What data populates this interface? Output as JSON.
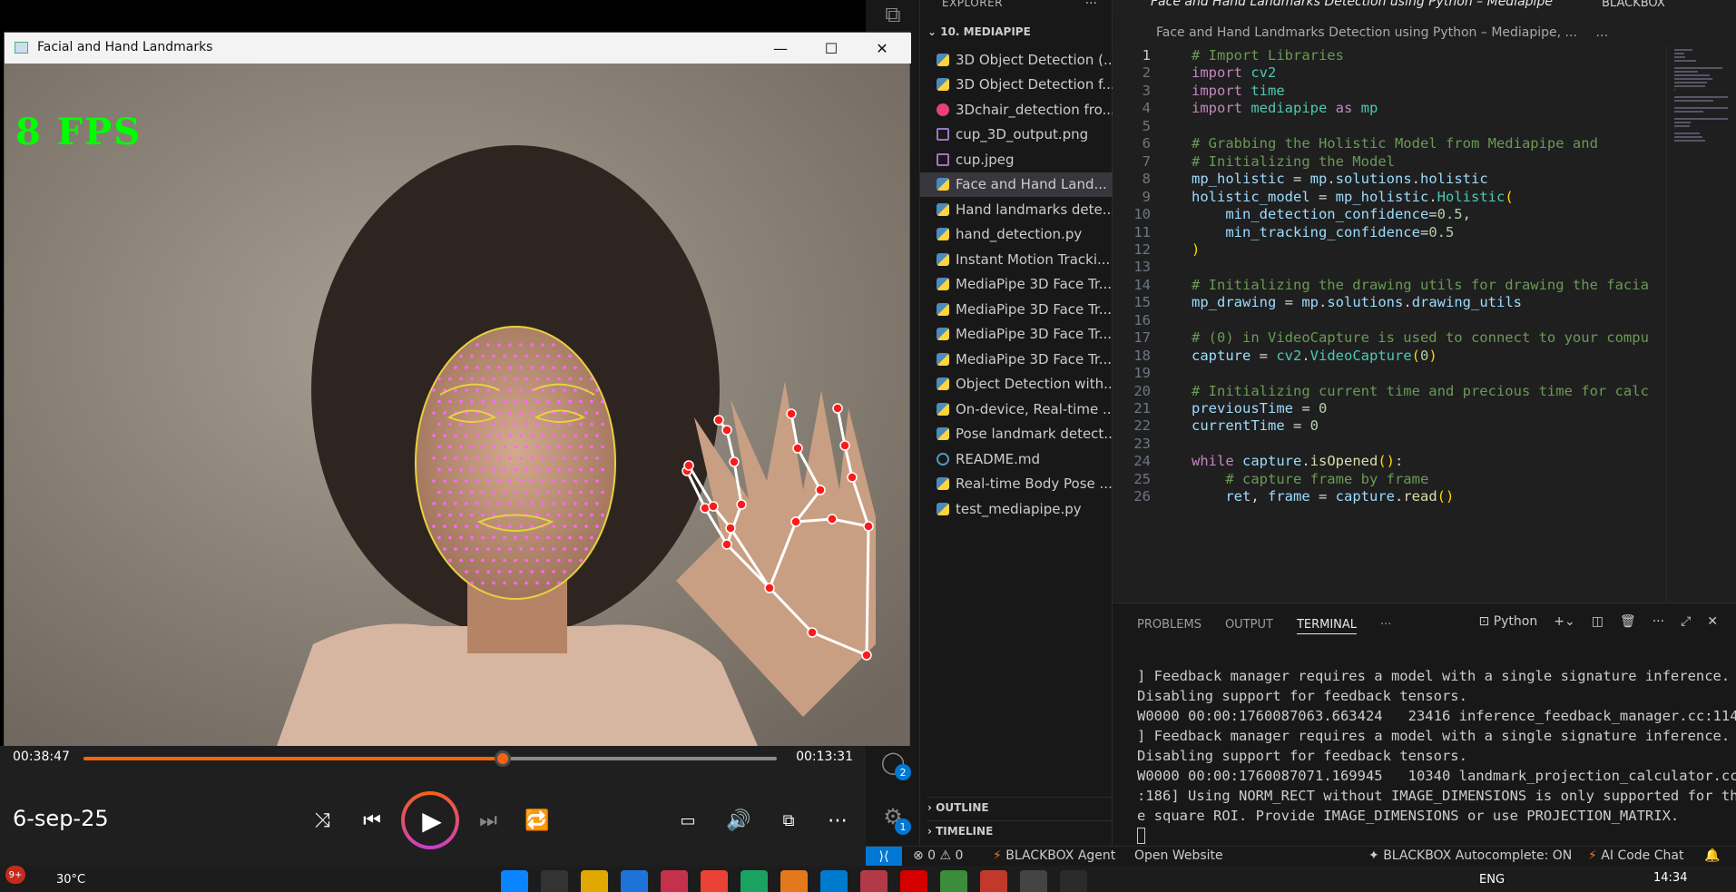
{
  "vscode": {
    "explorer_title": "EXPLORER",
    "explorer_more": "···",
    "folder": "10. MEDIAPIPE",
    "files": [
      {
        "name": "3D Object Detection (...",
        "type": "py"
      },
      {
        "name": "3D Object Detection f...",
        "type": "py"
      },
      {
        "name": "3Dchair_detection fro...",
        "type": "vid"
      },
      {
        "name": "cup_3D_output.png",
        "type": "img"
      },
      {
        "name": "cup.jpeg",
        "type": "img"
      },
      {
        "name": "Face and Hand Land...",
        "type": "py",
        "active": true
      },
      {
        "name": "Hand landmarks dete...",
        "type": "py"
      },
      {
        "name": "hand_detection.py",
        "type": "py"
      },
      {
        "name": "Instant Motion Tracki...",
        "type": "py"
      },
      {
        "name": "MediaPipe 3D Face Tr...",
        "type": "py"
      },
      {
        "name": "MediaPipe 3D Face Tr...",
        "type": "py"
      },
      {
        "name": "MediaPipe 3D Face Tr...",
        "type": "py"
      },
      {
        "name": "MediaPipe 3D Face Tr...",
        "type": "py"
      },
      {
        "name": "Object Detection with...",
        "type": "py"
      },
      {
        "name": "On-device, Real-time ...",
        "type": "py"
      },
      {
        "name": "Pose landmark detect...",
        "type": "py"
      },
      {
        "name": "README.md",
        "type": "info"
      },
      {
        "name": "Real-time Body Pose ...",
        "type": "py"
      },
      {
        "name": "test_mediapipe.py",
        "type": "py"
      }
    ],
    "outline_label": "OUTLINE",
    "timeline_label": "TIMELINE",
    "account_badge": "2",
    "settings_badge": "1",
    "tab_title": "Face and Hand Landmarks Detection using Python – Mediapipe",
    "blackbox_label": "BLACKBOX",
    "breadcrumb": "Face and Hand Landmarks Detection using Python – Mediapipe, ...",
    "breadcrumb_more": "…",
    "code": [
      {
        "n": "1",
        "parts": [
          [
            "c-cmt",
            "# Import Libraries"
          ]
        ]
      },
      {
        "n": "2",
        "parts": [
          [
            "c-kw",
            "import "
          ],
          [
            "c-mod",
            "cv2"
          ]
        ]
      },
      {
        "n": "3",
        "parts": [
          [
            "c-kw",
            "import "
          ],
          [
            "c-mod",
            "time"
          ]
        ]
      },
      {
        "n": "4",
        "parts": [
          [
            "c-kw",
            "import "
          ],
          [
            "c-mod",
            "mediapipe"
          ],
          [
            "c-kw",
            " as "
          ],
          [
            "c-mod",
            "mp"
          ]
        ]
      },
      {
        "n": "5",
        "parts": []
      },
      {
        "n": "6",
        "parts": [
          [
            "c-cmt",
            "# Grabbing the Holistic Model from Mediapipe and"
          ]
        ]
      },
      {
        "n": "7",
        "parts": [
          [
            "c-cmt",
            "# Initializing the Model"
          ]
        ]
      },
      {
        "n": "8",
        "parts": [
          [
            "c-var",
            "mp_holistic"
          ],
          [
            "c-pun",
            " = "
          ],
          [
            "c-var",
            "mp"
          ],
          [
            "c-pun",
            "."
          ],
          [
            "c-var",
            "solutions"
          ],
          [
            "c-pun",
            "."
          ],
          [
            "c-var",
            "holistic"
          ]
        ]
      },
      {
        "n": "9",
        "parts": [
          [
            "c-var",
            "holistic_model"
          ],
          [
            "c-pun",
            " = "
          ],
          [
            "c-var",
            "mp_holistic"
          ],
          [
            "c-pun",
            "."
          ],
          [
            "c-mod",
            "Holistic"
          ],
          [
            "c-br",
            "("
          ]
        ]
      },
      {
        "n": "10",
        "parts": [
          [
            "c-pun",
            "    "
          ],
          [
            "c-var",
            "min_detection_confidence"
          ],
          [
            "c-pun",
            "="
          ],
          [
            "c-num",
            "0.5"
          ],
          [
            "c-pun",
            ","
          ]
        ]
      },
      {
        "n": "11",
        "parts": [
          [
            "c-pun",
            "    "
          ],
          [
            "c-var",
            "min_tracking_confidence"
          ],
          [
            "c-pun",
            "="
          ],
          [
            "c-num",
            "0.5"
          ]
        ]
      },
      {
        "n": "12",
        "parts": [
          [
            "c-br",
            ")"
          ]
        ]
      },
      {
        "n": "13",
        "parts": []
      },
      {
        "n": "14",
        "parts": [
          [
            "c-cmt",
            "# Initializing the drawing utils for drawing the facia"
          ]
        ]
      },
      {
        "n": "15",
        "parts": [
          [
            "c-var",
            "mp_drawing"
          ],
          [
            "c-pun",
            " = "
          ],
          [
            "c-var",
            "mp"
          ],
          [
            "c-pun",
            "."
          ],
          [
            "c-var",
            "solutions"
          ],
          [
            "c-pun",
            "."
          ],
          [
            "c-var",
            "drawing_utils"
          ]
        ]
      },
      {
        "n": "16",
        "parts": []
      },
      {
        "n": "17",
        "parts": [
          [
            "c-cmt",
            "# (0) in VideoCapture is used to connect to your compu"
          ]
        ]
      },
      {
        "n": "18",
        "parts": [
          [
            "c-var",
            "capture"
          ],
          [
            "c-pun",
            " = "
          ],
          [
            "c-mod",
            "cv2"
          ],
          [
            "c-pun",
            "."
          ],
          [
            "c-mod",
            "VideoCapture"
          ],
          [
            "c-br",
            "("
          ],
          [
            "c-num",
            "0"
          ],
          [
            "c-br",
            ")"
          ]
        ]
      },
      {
        "n": "19",
        "parts": []
      },
      {
        "n": "20",
        "parts": [
          [
            "c-cmt",
            "# Initializing current time and precious time for calc"
          ]
        ]
      },
      {
        "n": "21",
        "parts": [
          [
            "c-var",
            "previousTime"
          ],
          [
            "c-pun",
            " = "
          ],
          [
            "c-num",
            "0"
          ]
        ]
      },
      {
        "n": "22",
        "parts": [
          [
            "c-var",
            "currentTime"
          ],
          [
            "c-pun",
            " = "
          ],
          [
            "c-num",
            "0"
          ]
        ]
      },
      {
        "n": "23",
        "parts": []
      },
      {
        "n": "24",
        "parts": [
          [
            "c-kw",
            "while "
          ],
          [
            "c-var",
            "capture"
          ],
          [
            "c-pun",
            "."
          ],
          [
            "c-fn",
            "isOpened"
          ],
          [
            "c-br",
            "()"
          ],
          [
            "c-pun",
            ":"
          ]
        ]
      },
      {
        "n": "25",
        "parts": [
          [
            "c-pun",
            "    "
          ],
          [
            "c-cmt",
            "# capture frame by frame"
          ]
        ]
      },
      {
        "n": "26",
        "parts": [
          [
            "c-pun",
            "    "
          ],
          [
            "c-var",
            "ret"
          ],
          [
            "c-pun",
            ", "
          ],
          [
            "c-var",
            "frame"
          ],
          [
            "c-pun",
            " = "
          ],
          [
            "c-var",
            "capture"
          ],
          [
            "c-pun",
            "."
          ],
          [
            "c-fn",
            "read"
          ],
          [
            "c-br",
            "()"
          ]
        ]
      }
    ],
    "panel_tabs": [
      "PROBLEMS",
      "OUTPUT",
      "TERMINAL",
      "···"
    ],
    "terminal_shell": "Python",
    "terminal": [
      "] Feedback manager requires a model with a single signature inference.",
      "Disabling support for feedback tensors.",
      "W0000 00:00:1760087063.663424   23416 inference_feedback_manager.cc:114",
      "] Feedback manager requires a model with a single signature inference.",
      "Disabling support for feedback tensors.",
      "W0000 00:00:1760087071.169945   10340 landmark_projection_calculator.cc",
      ":186] Using NORM_RECT without IMAGE_DIMENSIONS is only supported for th",
      "e square ROI. Provide IMAGE_DIMENSIONS or use PROJECTION_MATRIX.",
      ""
    ],
    "status": {
      "problems": "⊗ 0 ⚠ 0",
      "blackbox_agent": "BLACKBOX Agent",
      "open_website": "Open Website",
      "autocomplete": "BLACKBOX Autocomplete: ON",
      "ai_chat": "AI Code Chat"
    }
  },
  "player": {
    "window_title": "Facial and Hand Landmarks",
    "fps_text": "8 FPS",
    "time_elapsed": "00:38:47",
    "time_remaining": "00:13:31",
    "progress": 0.605,
    "title": "6-sep-25",
    "colors": {
      "accent": "#f7630c",
      "fps": "#00ff00"
    }
  },
  "taskbar": {
    "notif_badge": "9+",
    "weather": "30°C",
    "lang": "ENG",
    "time": "14:34"
  }
}
